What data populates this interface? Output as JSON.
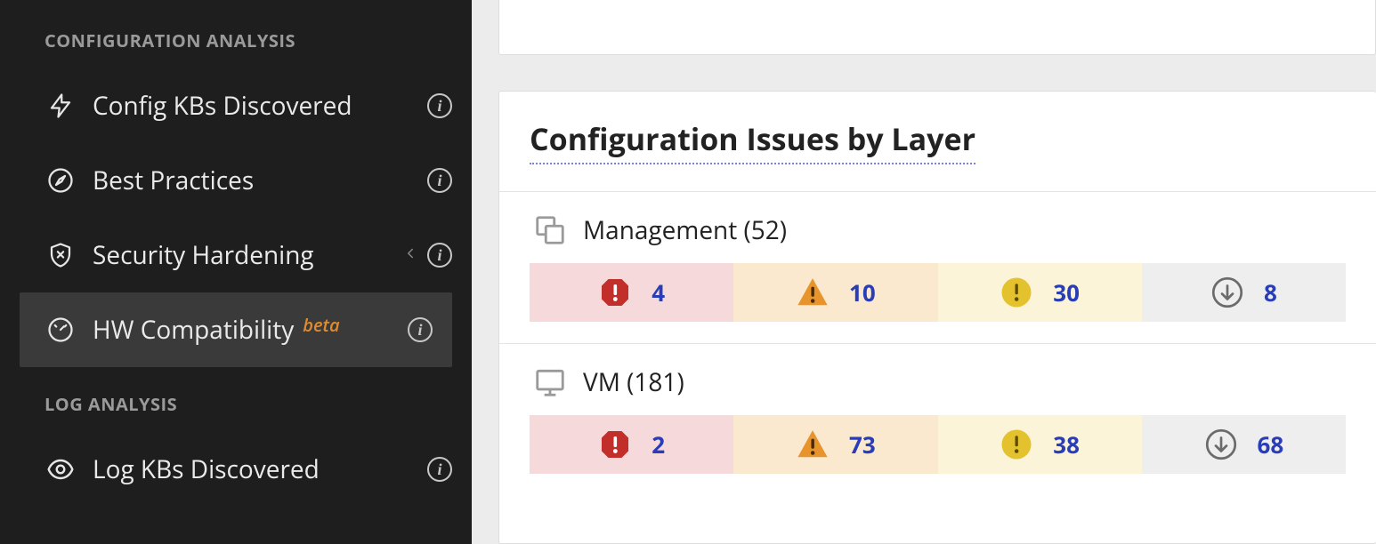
{
  "sidebar": {
    "section1_title": "CONFIGURATION ANALYSIS",
    "section2_title": "LOG ANALYSIS",
    "items": [
      {
        "label": "Config KBs Discovered"
      },
      {
        "label": "Best Practices"
      },
      {
        "label": "Security Hardening"
      },
      {
        "label": "HW Compatibility",
        "badge": "beta"
      },
      {
        "label": "Log KBs Discovered"
      }
    ]
  },
  "panel": {
    "title": "Configuration Issues by Layer",
    "layers": [
      {
        "name": "Management",
        "total": "52",
        "display": "Management (52)",
        "severities": {
          "critical": "4",
          "warning": "10",
          "moderate": "30",
          "info": "8"
        }
      },
      {
        "name": "VM",
        "total": "181",
        "display": "VM (181)",
        "severities": {
          "critical": "2",
          "warning": "73",
          "moderate": "38",
          "info": "68"
        }
      }
    ]
  },
  "chart_data": [
    {
      "type": "bar",
      "title": "Management severity breakdown",
      "categories": [
        "critical",
        "warning",
        "moderate",
        "info"
      ],
      "values": [
        4,
        10,
        30,
        8
      ]
    },
    {
      "type": "bar",
      "title": "VM severity breakdown",
      "categories": [
        "critical",
        "warning",
        "moderate",
        "info"
      ],
      "values": [
        2,
        73,
        38,
        68
      ]
    }
  ]
}
